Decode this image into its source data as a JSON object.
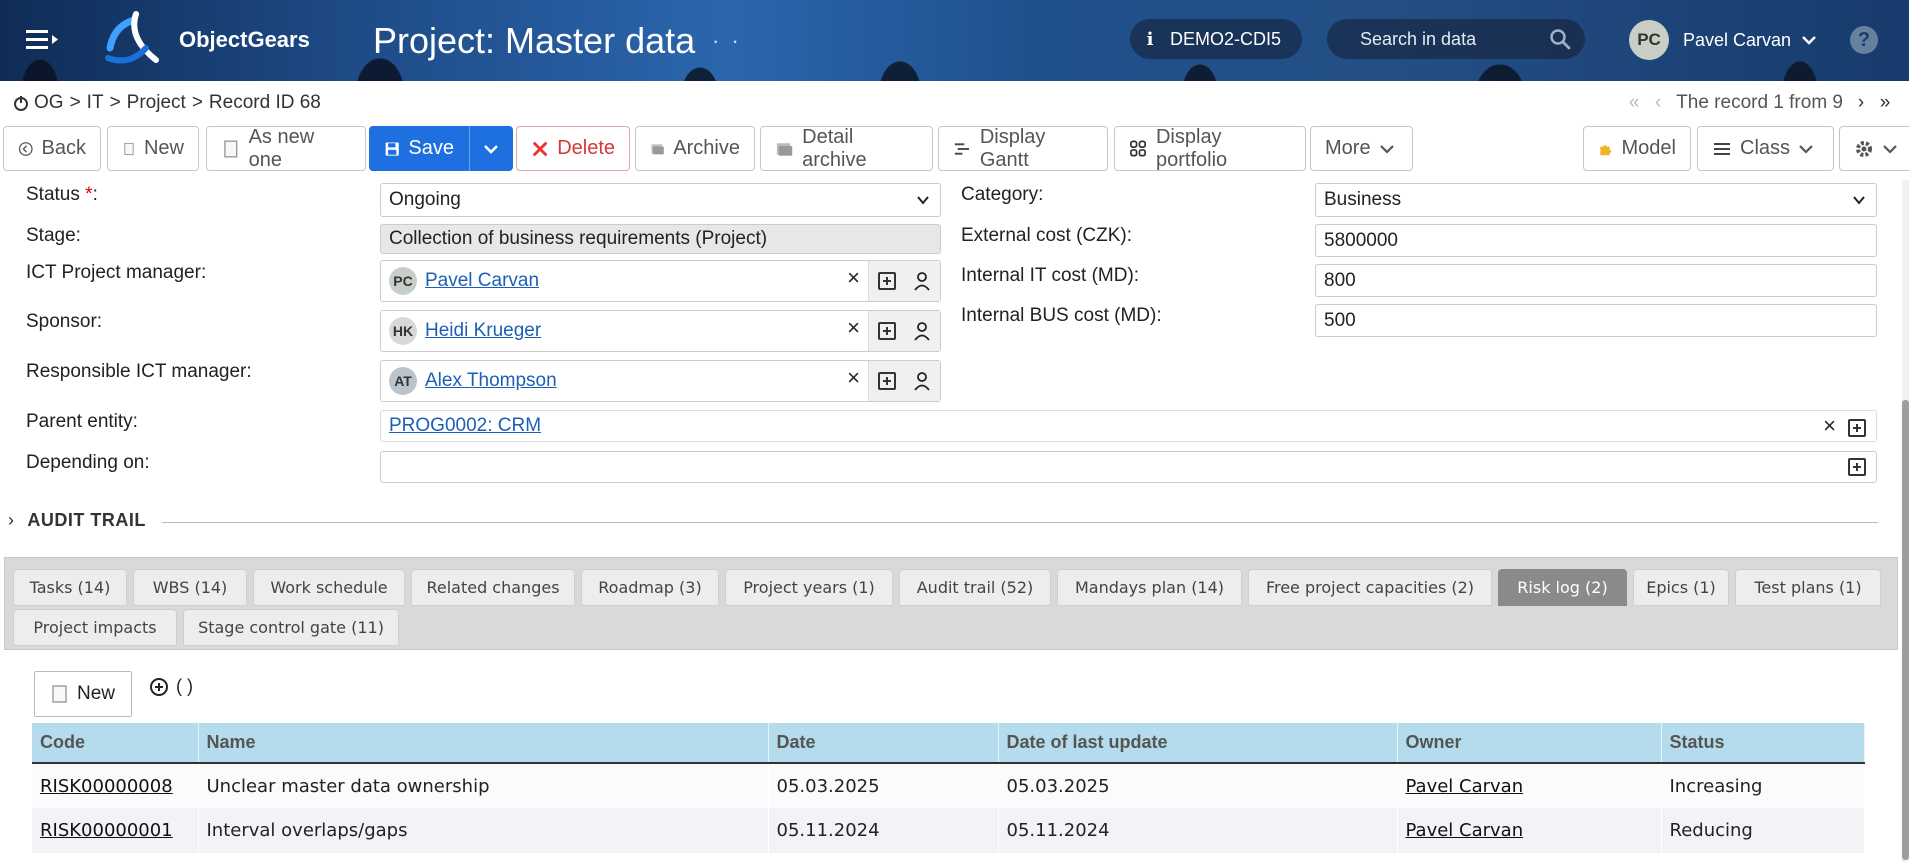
{
  "header": {
    "brand": "ObjectGears",
    "title": "Project: Master data",
    "environment": "DEMO2-CDI5",
    "search_placeholder": "Search in data",
    "user_initials": "PC",
    "user_name": "Pavel Carvan"
  },
  "breadcrumb": {
    "items": [
      "OG",
      "IT",
      "Project",
      "Record ID 68"
    ]
  },
  "pager": {
    "text": "The record 1 from 9"
  },
  "toolbar": {
    "back": "Back",
    "new": "New",
    "as_new": "As new one",
    "save": "Save",
    "delete": "Delete",
    "archive": "Archive",
    "detail_archive": "Detail archive",
    "display_gantt": "Display Gantt",
    "display_portfolio": "Display portfolio",
    "more": "More",
    "model": "Model",
    "class": "Class"
  },
  "form": {
    "status_label": "Status ",
    "status_required": "*",
    "status_colon": ":",
    "status_value": "Ongoing",
    "stage_label": "Stage:",
    "stage_value": "Collection of business requirements (Project)",
    "ict_pm_label": "ICT Project manager:",
    "ict_pm": {
      "initials": "PC",
      "name": "Pavel Carvan"
    },
    "sponsor_label": "Sponsor:",
    "sponsor": {
      "initials": "HK",
      "name": "Heidi Krueger"
    },
    "resp_ict_label": "Responsible ICT manager:",
    "resp_ict": {
      "initials": "AT",
      "name": "Alex Thompson"
    },
    "parent_label": "Parent entity:",
    "parent_value": "PROG0002: CRM",
    "depending_label": "Depending on:",
    "depending_value": "",
    "category_label": "Category:",
    "category_value": "Business",
    "ext_cost_label": "External cost (CZK):",
    "ext_cost_value": "5800000",
    "int_it_label": "Internal IT cost (MD):",
    "int_it_value": "800",
    "int_bus_label": "Internal BUS cost (MD):",
    "int_bus_value": "500"
  },
  "audit_trail": {
    "title": "AUDIT TRAIL"
  },
  "tabs": [
    {
      "label": "Tasks (14)"
    },
    {
      "label": "WBS (14)"
    },
    {
      "label": "Work schedule"
    },
    {
      "label": "Related changes"
    },
    {
      "label": "Roadmap (3)"
    },
    {
      "label": "Project years (1)"
    },
    {
      "label": "Audit trail (52)"
    },
    {
      "label": "Mandays plan (14)"
    },
    {
      "label": "Free project capacities (2)"
    },
    {
      "label": "Risk log (2)"
    },
    {
      "label": "Epics (1)"
    },
    {
      "label": "Test plans (1)"
    },
    {
      "label": "Project impacts"
    },
    {
      "label": "Stage control gate (11)"
    }
  ],
  "grid": {
    "new_label": "New",
    "extra_label": "( )",
    "columns": [
      "Code",
      "Name",
      "Date",
      "Date of last update",
      "Owner",
      "Status"
    ],
    "rows": [
      [
        "RISK00000008",
        "Unclear master data ownership",
        "05.03.2025",
        "05.03.2025",
        "Pavel Carvan",
        "Increasing"
      ],
      [
        "RISK00000001",
        "Interval overlaps/gaps",
        "05.11.2024",
        "05.11.2024",
        "Pavel Carvan",
        "Reducing"
      ]
    ]
  }
}
